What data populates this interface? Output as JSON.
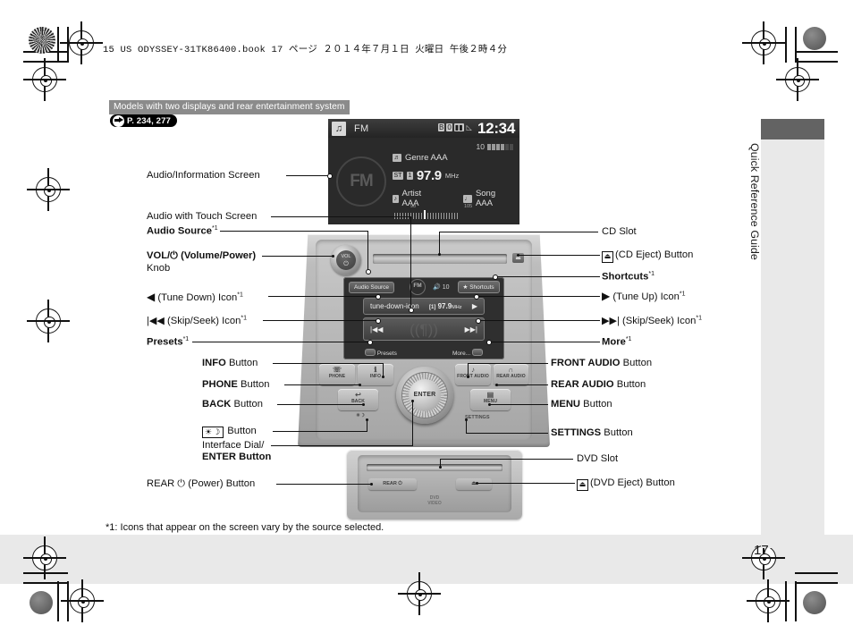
{
  "print_slug": "15 US ODYSSEY-31TK86400.book   17 ページ   ２０１４年７月１日   火曜日   午後２時４分",
  "side_tab": {
    "label": "Quick Reference Guide"
  },
  "page_number": "17",
  "banner": {
    "models_note": "Models with two displays and rear entertainment system",
    "page_ref": "P. 234, 277"
  },
  "footnote": "*1: Icons that appear on the screen vary by the source selected.",
  "audio_screen": {
    "music_icon": "music-note-icon",
    "band": "FM",
    "status_icons": [
      "bluetooth-icon",
      "signal-zero-icon",
      "battery-icon",
      "antenna-icon"
    ],
    "clock": "12:34",
    "volume_label": "10",
    "logo": "FM",
    "rows": [
      {
        "chip": "genre-icon",
        "text": "Genre AAA"
      },
      {
        "chip": "station-icon",
        "text": "97.9",
        "unit": "MHz"
      },
      {
        "chip": "artist-icon",
        "text": "Artist AAA"
      },
      {
        "chip": "song-icon",
        "text": "Song AAA"
      }
    ],
    "scale": {
      "left_tick": "90",
      "right_tick": "105"
    }
  },
  "touch_screen": {
    "audio_source": "Audio Source",
    "source_logo": "FM",
    "volume": "10",
    "shortcuts": "Shortcuts",
    "preset_num": "[1]",
    "frequency": "97.9",
    "frequency_unit": "MHz",
    "tune_down_icon": "tune-down-icon",
    "tune_up_icon": "tune-up-icon",
    "skip_back_icon": "skip-back-icon",
    "skip_forward_icon": "skip-forward-icon",
    "presets": "Presets",
    "more": "More..."
  },
  "head_unit": {
    "vol_knob_label": "VOL",
    "cd_eject_glyph": "⏏",
    "buttons": [
      {
        "name": "phone",
        "label": "PHONE",
        "glyph": "☏"
      },
      {
        "name": "info",
        "label": "INFO",
        "glyph": "ℹ"
      },
      {
        "name": "front-audio",
        "label": "FRONT AUDIO",
        "glyph": "♪"
      },
      {
        "name": "rear-audio",
        "label": "REAR AUDIO",
        "glyph": "∩"
      },
      {
        "name": "back",
        "label": "BACK",
        "glyph": "↩"
      },
      {
        "name": "menu",
        "label": "MENU",
        "glyph": "▤"
      }
    ],
    "enter_label": "ENTER",
    "day_night_label": "☀☽",
    "settings_label": "SETTINGS"
  },
  "dvd_unit": {
    "rear_power_label": "REAR ⏻",
    "eject_glyph": "⏏",
    "logo_line1": "DVD",
    "logo_line2": "VIDEO"
  },
  "callouts_left": [
    {
      "key": "audio-information-screen",
      "text": "Audio/Information Screen",
      "bold": false
    },
    {
      "key": "audio-with-touch-screen",
      "text": "Audio with Touch Screen",
      "bold": false
    },
    {
      "key": "audio-source",
      "text": "Audio Source",
      "bold": true,
      "sup": "*1"
    },
    {
      "key": "vol-power-knob",
      "text": "VOL/⏻ (Volume/Power)",
      "bold": true,
      "line2": "Knob"
    },
    {
      "key": "tune-down-icon",
      "text": "(Tune Down) Icon",
      "sup": "*1",
      "glyph": "◀"
    },
    {
      "key": "skip-seek-back-icon",
      "text": "(Skip/Seek) Icon",
      "sup": "*1",
      "glyph": "|◀◀"
    },
    {
      "key": "presets",
      "text": "Presets",
      "bold": true,
      "sup": "*1"
    },
    {
      "key": "info-button",
      "text": "INFO",
      "bold": true,
      "suffix": " Button"
    },
    {
      "key": "phone-button",
      "text": "PHONE",
      "bold": true,
      "suffix": " Button"
    },
    {
      "key": "back-button",
      "text": "BACK",
      "bold": true,
      "suffix": " Button"
    },
    {
      "key": "day-night-button",
      "text": "☀☽",
      "suffix": " Button",
      "boxed": true
    },
    {
      "key": "interface-dial-enter-button",
      "text": "Interface Dial/",
      "line2": "ENTER Button"
    },
    {
      "key": "rear-power-button",
      "text": "REAR ⏻ (Power) Button"
    }
  ],
  "callouts_right": [
    {
      "key": "cd-slot",
      "text": "CD Slot"
    },
    {
      "key": "cd-eject-button",
      "text": "(CD Eject) Button",
      "boxed_glyph": "⏏"
    },
    {
      "key": "shortcuts",
      "text": "Shortcuts",
      "bold": true,
      "sup": "*1"
    },
    {
      "key": "tune-up-icon",
      "text": "(Tune Up) Icon",
      "sup": "*1",
      "glyph": "▶"
    },
    {
      "key": "skip-seek-forward-icon",
      "text": "(Skip/Seek) Icon",
      "sup": "*1",
      "glyph": "▶▶|"
    },
    {
      "key": "more",
      "text": "More",
      "bold": true,
      "sup": "*1"
    },
    {
      "key": "front-audio-button",
      "text": "FRONT AUDIO",
      "bold": true,
      "suffix": " Button"
    },
    {
      "key": "rear-audio-button",
      "text": "REAR AUDIO",
      "bold": true,
      "suffix": " Button"
    },
    {
      "key": "menu-button",
      "text": "MENU",
      "bold": true,
      "suffix": " Button"
    },
    {
      "key": "settings-button",
      "text": "SETTINGS",
      "bold": true,
      "suffix": " Button"
    },
    {
      "key": "dvd-slot",
      "text": "DVD Slot"
    },
    {
      "key": "dvd-eject-button",
      "text": "(DVD Eject) Button",
      "boxed_glyph": "⏏"
    }
  ]
}
